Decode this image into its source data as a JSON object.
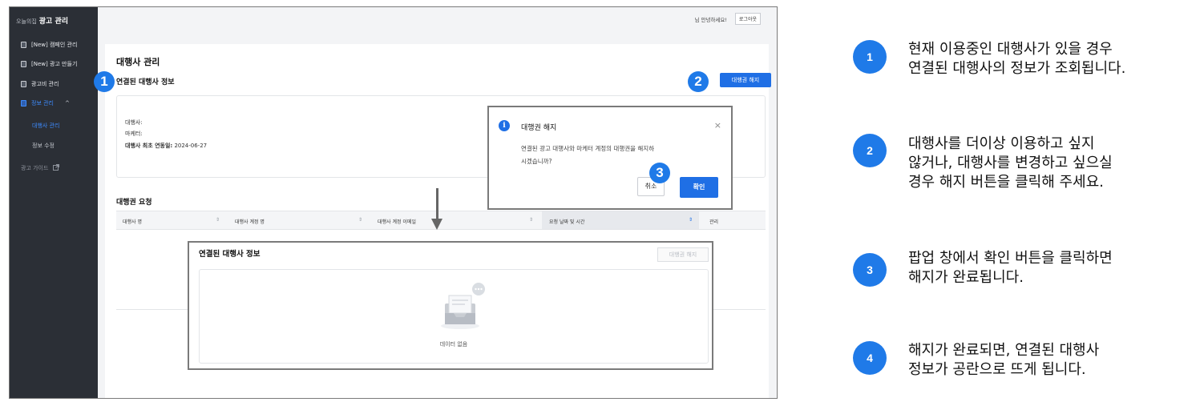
{
  "sidebar": {
    "brand_small": "오늘의집",
    "brand_title": "광고 관리",
    "items": [
      {
        "label": "[New] 캠페인 관리"
      },
      {
        "label": "[New] 광고 만들기"
      },
      {
        "label": "광고비 관리"
      },
      {
        "label": "정보 관리"
      }
    ],
    "sub_items": [
      {
        "label": "대행사 관리"
      },
      {
        "label": "정보 수정"
      }
    ],
    "guide": "광고 가이드",
    "chevron": "^"
  },
  "topbar": {
    "greeting": "님 안녕하세요!",
    "logout": "로그아웃"
  },
  "page": {
    "title": "대행사 관리",
    "section1_title": "연결된 대행사 정보",
    "revoke_button": "대행권 해지",
    "info": {
      "agency_label": "대행사:",
      "marketer_label": "마케터:",
      "first_linked_label": "대행사 최초 연동일:",
      "first_linked_value": "2024-06-27"
    },
    "section2_title": "대행권 요청",
    "table_headers": [
      "대행사 명",
      "대행사 계정 명",
      "대행사 계정 이메일",
      "요청 날짜 및 시간",
      "관리"
    ],
    "sort_icon": "⇕"
  },
  "dialog": {
    "icon": "i",
    "title": "대행권 해지",
    "close": "×",
    "message_line1": "연결된 광고 대행사와 마케터 계정의 대행권을 해지하",
    "message_line2": "시겠습니까?",
    "cancel": "취소",
    "confirm": "확인"
  },
  "after": {
    "title": "연결된 대행사 정보",
    "button": "대행권 해지",
    "empty_text": "데이터 없음"
  },
  "badges": [
    "1",
    "2",
    "3"
  ],
  "guide": [
    {
      "num": "1",
      "text": "현재 이용중인 대행사가 있을 경우\n연결된 대행사의 정보가 조회됩니다."
    },
    {
      "num": "2",
      "text": "대행사를 더이상 이용하고 싶지\n않거나, 대행사를 변경하고 싶으실\n경우 해지 버튼을 클릭해 주세요."
    },
    {
      "num": "3",
      "text": "팝업 창에서 확인 버튼을 클릭하면\n해지가 완료됩니다."
    },
    {
      "num": "4",
      "text": "해지가 완료되면, 연결된 대행사\n정보가 공란으로 뜨게 됩니다."
    }
  ],
  "colors": {
    "accent": "#1f6fe5",
    "sidebar_bg": "#2b2f36",
    "badge": "#1f7ae8"
  },
  "icons": [
    "document-icon",
    "external-link-icon",
    "info-icon",
    "close-icon",
    "sort-icon",
    "empty-inbox-icon",
    "chevron-up-icon"
  ]
}
